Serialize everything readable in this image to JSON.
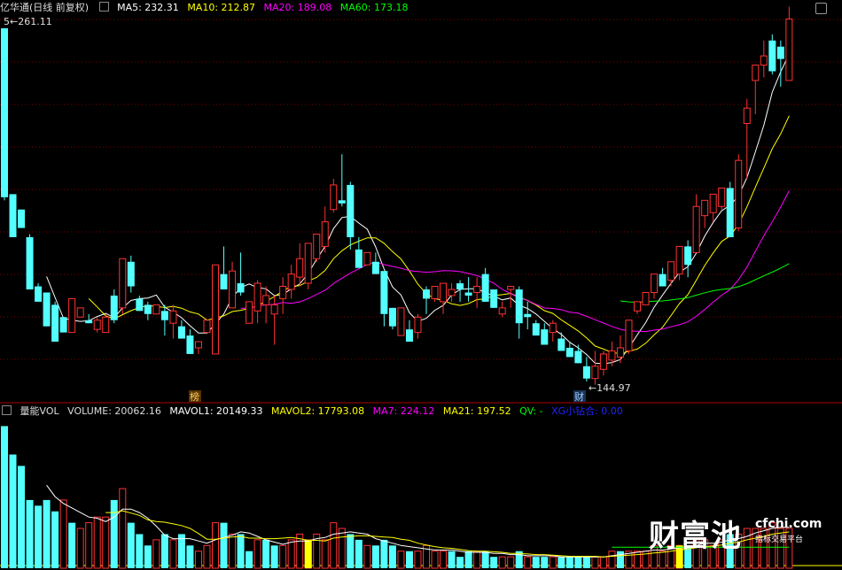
{
  "header": {
    "title": "亿华通(日线 前复权)",
    "ma5": "MA5: 232.31",
    "ma10": "MA10: 212.87",
    "ma20": "MA20: 189.08",
    "ma60": "MA60: 173.18"
  },
  "vol_header": {
    "title": "量能VOL",
    "volume": "VOLUME: 20062.16",
    "mavol1": "MAVOL1: 20149.33",
    "mavol2": "MAVOL2: 17793.08",
    "ma7": "MA7: 224.12",
    "ma21": "MA21: 197.52",
    "qv": "QV: -",
    "xg": "XG小钻合: 0.00"
  },
  "logo": {
    "main": "财富池",
    "site": "cfchi.com",
    "sub": "指标交易平台"
  },
  "colors": {
    "up": "#ff3232",
    "down": "#54ffff",
    "ma5": "#ffffff",
    "ma10": "#ffff00",
    "ma20": "#ff00ff",
    "ma60": "#00ff00",
    "qv": "#00ff00",
    "xg": "#0000ff",
    "grid": "#7f0000",
    "axis": "#aa0000"
  },
  "chart_data": {
    "type": "candlestick",
    "ylim": [
      140,
      265
    ],
    "annotations": {
      "high_label": "261.11",
      "low_label": "144.97",
      "mark_bang": "榜",
      "mark_cai": "财"
    },
    "candles": [
      [
        0,
        261,
        261,
        205,
        206
      ],
      [
        1,
        207,
        207,
        193,
        193
      ],
      [
        2,
        202,
        202,
        196,
        196
      ],
      [
        3,
        193,
        194,
        176,
        176
      ],
      [
        4,
        177,
        178,
        172,
        172
      ],
      [
        5,
        175,
        175,
        164,
        164
      ],
      [
        6,
        171,
        172,
        159,
        159
      ],
      [
        7,
        167,
        167,
        162,
        162
      ],
      [
        8,
        162,
        173,
        162,
        173
      ],
      [
        9,
        167,
        170,
        167,
        170
      ],
      [
        10,
        166,
        168,
        165,
        165
      ],
      [
        11,
        163,
        167,
        162,
        166
      ],
      [
        12,
        162,
        168,
        162,
        167
      ],
      [
        13,
        174,
        176,
        165,
        166
      ],
      [
        14,
        170,
        186,
        168,
        186
      ],
      [
        15,
        185,
        187,
        175,
        177
      ],
      [
        16,
        173,
        174,
        169,
        169
      ],
      [
        17,
        171,
        172,
        166,
        168
      ],
      [
        18,
        168,
        171,
        168,
        171
      ],
      [
        19,
        169,
        171,
        161,
        166
      ],
      [
        20,
        165,
        171,
        160,
        169
      ],
      [
        21,
        164,
        166,
        160,
        160
      ],
      [
        22,
        161,
        163,
        155,
        155
      ],
      [
        23,
        157,
        159,
        155,
        159
      ],
      [
        24,
        162,
        166,
        162,
        166
      ],
      [
        25,
        155,
        184,
        155,
        184
      ],
      [
        26,
        181,
        190,
        176,
        176
      ],
      [
        27,
        170,
        185,
        171,
        182
      ],
      [
        28,
        178,
        188,
        174,
        175
      ],
      [
        29,
        165,
        172,
        165,
        172
      ],
      [
        30,
        169,
        179,
        165,
        178
      ],
      [
        31,
        171,
        177,
        165,
        174
      ],
      [
        32,
        168,
        174,
        158,
        171
      ],
      [
        33,
        173,
        180,
        168,
        177
      ],
      [
        34,
        176,
        184,
        173,
        181
      ],
      [
        35,
        180,
        191,
        177,
        186
      ],
      [
        36,
        178,
        191,
        176,
        191
      ],
      [
        37,
        186,
        194,
        185,
        194
      ],
      [
        38,
        190,
        203,
        188,
        198
      ],
      [
        39,
        202,
        212,
        201,
        210
      ],
      [
        40,
        205,
        220,
        203,
        204
      ],
      [
        41,
        210,
        211,
        189,
        193
      ],
      [
        42,
        189,
        193,
        183,
        183
      ],
      [
        43,
        184,
        188,
        184,
        188
      ],
      [
        44,
        185,
        188,
        181,
        181
      ],
      [
        45,
        182,
        182,
        164,
        168
      ],
      [
        46,
        170,
        170,
        163,
        164
      ],
      [
        47,
        161,
        170,
        161,
        170
      ],
      [
        48,
        163,
        166,
        159,
        159
      ],
      [
        49,
        162,
        168,
        160,
        167
      ],
      [
        50,
        176,
        177,
        168,
        173
      ],
      [
        51,
        173,
        177,
        172,
        177
      ],
      [
        52,
        172,
        178,
        168,
        178
      ],
      [
        53,
        174,
        178,
        172,
        176
      ],
      [
        54,
        178,
        179,
        172,
        176
      ],
      [
        55,
        175,
        180,
        172,
        174
      ],
      [
        56,
        175,
        180,
        170,
        177
      ],
      [
        57,
        181,
        183,
        172,
        172
      ],
      [
        58,
        176,
        176,
        170,
        170
      ],
      [
        59,
        168,
        172,
        167,
        170
      ],
      [
        60,
        176,
        177,
        170,
        177
      ],
      [
        61,
        176,
        177,
        160,
        165
      ],
      [
        62,
        168,
        172,
        163,
        167
      ],
      [
        63,
        165,
        166,
        161,
        161
      ],
      [
        64,
        163,
        165,
        158,
        158
      ],
      [
        65,
        162,
        166,
        159,
        165
      ],
      [
        66,
        160,
        162,
        156,
        156
      ],
      [
        67,
        157,
        159,
        154,
        154
      ],
      [
        68,
        156,
        158,
        152,
        152
      ],
      [
        69,
        151,
        154,
        146,
        147
      ],
      [
        70,
        147,
        156,
        145,
        151
      ],
      [
        71,
        150,
        156,
        148,
        155
      ],
      [
        72,
        153,
        159,
        151,
        156
      ],
      [
        73,
        154,
        161,
        152,
        157
      ],
      [
        74,
        156,
        166,
        155,
        166
      ],
      [
        75,
        169,
        172,
        168,
        172
      ],
      [
        76,
        171,
        175,
        171,
        175
      ],
      [
        77,
        175,
        181,
        173,
        181
      ],
      [
        78,
        181,
        183,
        177,
        177
      ],
      [
        79,
        179,
        185,
        177,
        185
      ],
      [
        80,
        181,
        190,
        179,
        190
      ],
      [
        81,
        190,
        192,
        180,
        184
      ],
      [
        82,
        188,
        207,
        188,
        203
      ],
      [
        83,
        200,
        205,
        196,
        205
      ],
      [
        84,
        201,
        207,
        198,
        207
      ],
      [
        85,
        203,
        209,
        202,
        209
      ],
      [
        86,
        209,
        211,
        193,
        193
      ],
      [
        87,
        196,
        220,
        195,
        218
      ],
      [
        88,
        230,
        238,
        212,
        235
      ],
      [
        89,
        244,
        249,
        233,
        249
      ],
      [
        90,
        249,
        257,
        245,
        252
      ],
      [
        91,
        257,
        259,
        246,
        247
      ],
      [
        92,
        255,
        257,
        242,
        251
      ],
      [
        93,
        244,
        268,
        244,
        264
      ]
    ],
    "volume": [
      [
        0,
        25,
        0
      ],
      [
        1,
        20,
        0
      ],
      [
        2,
        18,
        0
      ],
      [
        3,
        12,
        0
      ],
      [
        4,
        11,
        0
      ],
      [
        5,
        12,
        0
      ],
      [
        6,
        10,
        0
      ],
      [
        7,
        12,
        1
      ],
      [
        8,
        8,
        0
      ],
      [
        9,
        7,
        1
      ],
      [
        10,
        8,
        1
      ],
      [
        11,
        9,
        1
      ],
      [
        12,
        9,
        1
      ],
      [
        13,
        12,
        0
      ],
      [
        14,
        14,
        1
      ],
      [
        15,
        8,
        0
      ],
      [
        16,
        6,
        0
      ],
      [
        17,
        4,
        0
      ],
      [
        18,
        5,
        1
      ],
      [
        19,
        6,
        0
      ],
      [
        20,
        5,
        1
      ],
      [
        21,
        6,
        0
      ],
      [
        22,
        4,
        0
      ],
      [
        23,
        3,
        1
      ],
      [
        24,
        4,
        1
      ],
      [
        25,
        8,
        1
      ],
      [
        26,
        8,
        0
      ],
      [
        27,
        6,
        1
      ],
      [
        28,
        6,
        0
      ],
      [
        29,
        3,
        0
      ],
      [
        30,
        5,
        1
      ],
      [
        31,
        5,
        0
      ],
      [
        32,
        4,
        0
      ],
      [
        33,
        4,
        1
      ],
      [
        34,
        5,
        1
      ],
      [
        35,
        6,
        1
      ],
      [
        36,
        5,
        1
      ],
      [
        37,
        6,
        1
      ],
      [
        38,
        5,
        1
      ],
      [
        39,
        8,
        1
      ],
      [
        40,
        7,
        1
      ],
      [
        41,
        6,
        0
      ],
      [
        42,
        5,
        0
      ],
      [
        43,
        4,
        1
      ],
      [
        44,
        4,
        0
      ],
      [
        45,
        5,
        0
      ],
      [
        46,
        4,
        0
      ],
      [
        47,
        3,
        1
      ],
      [
        48,
        3,
        0
      ],
      [
        49,
        3,
        1
      ],
      [
        50,
        4,
        1
      ],
      [
        51,
        3,
        1
      ],
      [
        52,
        3,
        1
      ],
      [
        53,
        3,
        0
      ],
      [
        54,
        2,
        0
      ],
      [
        55,
        3,
        0
      ],
      [
        56,
        3,
        1
      ],
      [
        57,
        3,
        0
      ],
      [
        58,
        2,
        0
      ],
      [
        59,
        2,
        1
      ],
      [
        60,
        2,
        1
      ],
      [
        61,
        3,
        0
      ],
      [
        62,
        2,
        1
      ],
      [
        63,
        2,
        0
      ],
      [
        64,
        2,
        0
      ],
      [
        65,
        2,
        1
      ],
      [
        66,
        2,
        0
      ],
      [
        67,
        2,
        0
      ],
      [
        68,
        2,
        0
      ],
      [
        69,
        2,
        0
      ],
      [
        70,
        2,
        1
      ],
      [
        71,
        2,
        1
      ],
      [
        72,
        3,
        1
      ],
      [
        73,
        3,
        0
      ],
      [
        74,
        3,
        1
      ],
      [
        75,
        3,
        1
      ],
      [
        76,
        3,
        1
      ],
      [
        77,
        4,
        1
      ],
      [
        78,
        3,
        1
      ],
      [
        79,
        4,
        1
      ],
      [
        80,
        4,
        1
      ],
      [
        81,
        4,
        0
      ],
      [
        82,
        5,
        1
      ],
      [
        83,
        5,
        1
      ],
      [
        84,
        4,
        1
      ],
      [
        85,
        5,
        1
      ],
      [
        86,
        6,
        0
      ],
      [
        87,
        6,
        1
      ],
      [
        88,
        7,
        1
      ],
      [
        89,
        7,
        1
      ],
      [
        90,
        7,
        1
      ],
      [
        91,
        8,
        1
      ],
      [
        92,
        7,
        1
      ],
      [
        93,
        7,
        1
      ]
    ]
  }
}
